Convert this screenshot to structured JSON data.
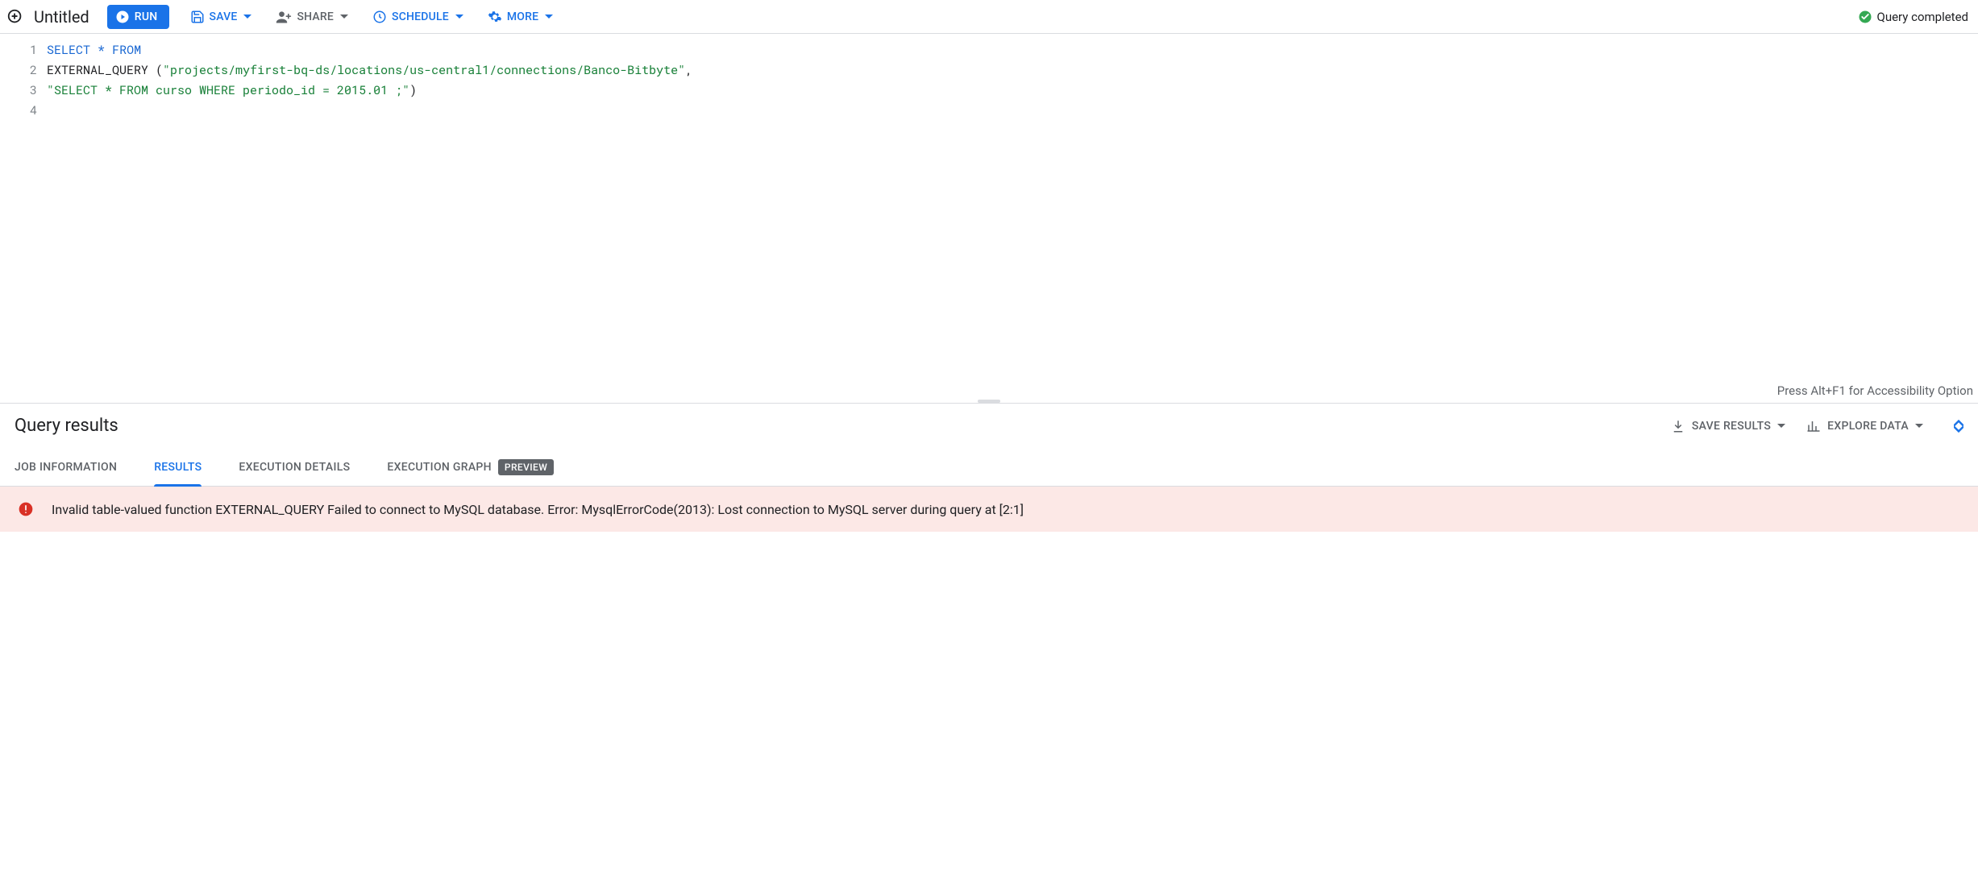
{
  "toolbar": {
    "title": "Untitled",
    "run": "RUN",
    "save": "SAVE",
    "share": "SHARE",
    "schedule": "SCHEDULE",
    "more": "MORE",
    "status": "Query completed"
  },
  "editor": {
    "a11y_hint": "Press Alt+F1 for Accessibility Option",
    "lines": [
      {
        "n": "1",
        "tokens": [
          [
            "kw",
            "SELECT"
          ],
          [
            "pn",
            " "
          ],
          [
            "kw",
            "*"
          ],
          [
            "pn",
            " "
          ],
          [
            "kw",
            "FROM"
          ]
        ]
      },
      {
        "n": "2",
        "tokens": [
          [
            "fn",
            "EXTERNAL_QUERY "
          ],
          [
            "pn",
            "("
          ],
          [
            "str",
            "\"projects/myfirst-bq-ds/locations/us-central1/connections/Banco-Bitbyte\""
          ],
          [
            "pn",
            ","
          ]
        ]
      },
      {
        "n": "3",
        "tokens": [
          [
            "str",
            "\"SELECT * FROM curso WHERE periodo_id = 2015.01 ;\""
          ],
          [
            "pn",
            ")"
          ]
        ]
      },
      {
        "n": "4",
        "tokens": []
      }
    ]
  },
  "results": {
    "heading": "Query results",
    "save_results": "SAVE RESULTS",
    "explore_data": "EXPLORE DATA"
  },
  "tabs": {
    "job_info": "JOB INFORMATION",
    "results": "RESULTS",
    "exec_details": "EXECUTION DETAILS",
    "exec_graph": "EXECUTION GRAPH",
    "preview_badge": "PREVIEW"
  },
  "error": {
    "message": "Invalid table-valued function EXTERNAL_QUERY Failed to connect to MySQL database. Error: MysqlErrorCode(2013): Lost connection to MySQL server during query at [2:1]"
  }
}
